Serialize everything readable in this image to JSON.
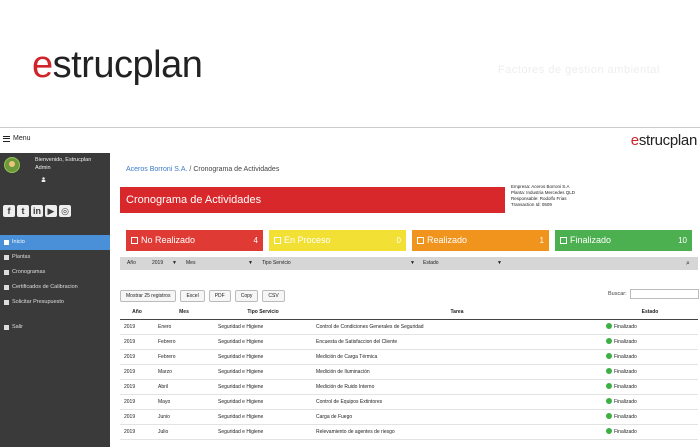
{
  "hero": {
    "logo_prefix": "e",
    "logo_rest": "strucplan",
    "tagline": "Factores de gestion ambiental"
  },
  "topbar": {
    "menu_label": "Menu",
    "logo_prefix": "e",
    "logo_rest": "strucplan"
  },
  "user": {
    "welcome": "Bienvenido, Estrucplan",
    "role": "Admin"
  },
  "social": [
    "f",
    "t",
    "in",
    "▶",
    "◎"
  ],
  "nav": [
    {
      "label": "Inicio",
      "icon": "home-icon"
    },
    {
      "label": "Plantas",
      "icon": "plane-icon"
    },
    {
      "label": "Cronogramas",
      "icon": "calendar-icon"
    },
    {
      "label": "Certificados de Calibracion",
      "icon": "certificate-icon"
    },
    {
      "label": "Solicitar Presupuesto",
      "icon": "edit-icon"
    },
    {
      "label": "Salir",
      "icon": "logout-icon"
    }
  ],
  "breadcrumb": {
    "company": "Aceros Borroni S.A.",
    "sep": "/",
    "current": "Cronograma de Actividades"
  },
  "title": "Cronograma de Actividades",
  "info": {
    "empresa": "Empresa: Aceros Borroni S.A",
    "planta": "Planta: Industria Mercedes QLD",
    "responsable": "Responsable: Rodolfo Frias",
    "transaction": "Transaction Id: 0509"
  },
  "cards": [
    {
      "label": "No Realizado",
      "count": "4"
    },
    {
      "label": "En Proceso",
      "count": "0"
    },
    {
      "label": "Realizado",
      "count": "1"
    },
    {
      "label": "Finalizado",
      "count": "10"
    }
  ],
  "filter": {
    "anio_label": "Año",
    "anio_value": "2019",
    "mes": "Mes",
    "tipo": "Tipo Servicio",
    "estado": "Estado"
  },
  "tools": {
    "show": "Mostrar 25 registros",
    "excel": "Excel",
    "pdf": "PDF",
    "copy": "Copy",
    "csv": "CSV",
    "search_label": "Buscar:"
  },
  "columns": [
    "Año",
    "Mes",
    "Tipo Servicio",
    "Tarea",
    "Estado"
  ],
  "rows": [
    [
      "2019",
      "Enero",
      "Seguridad e Higiene",
      "Control de Condiciones Generales de Seguridad",
      "Finalizado"
    ],
    [
      "2019",
      "Febrero",
      "Seguridad e Higiene",
      "Encuesta de Satisfaccion del Cliente",
      "Finalizado"
    ],
    [
      "2019",
      "Febrero",
      "Seguridad e Higiene",
      "Medición de Carga Térmica",
      "Finalizado"
    ],
    [
      "2019",
      "Marzo",
      "Seguridad e Higiene",
      "Medición de Iluminación",
      "Finalizado"
    ],
    [
      "2019",
      "Abril",
      "Seguridad e Higiene",
      "Medición de Ruido Interno",
      "Finalizado"
    ],
    [
      "2019",
      "Mayo",
      "Seguridad e Higiene",
      "Control de Equipos Extintores",
      "Finalizado"
    ],
    [
      "2019",
      "Junio",
      "Seguridad e Higiene",
      "Carga de Fuego",
      "Finalizado"
    ],
    [
      "2019",
      "Julio",
      "Seguridad e Higiene",
      "Relevamiento de agentes de riesgo",
      "Finalizado"
    ]
  ],
  "colors": {
    "accent": "#d9282b",
    "nav_active": "#4a90d9",
    "sidebar": "#3a3a3a"
  }
}
